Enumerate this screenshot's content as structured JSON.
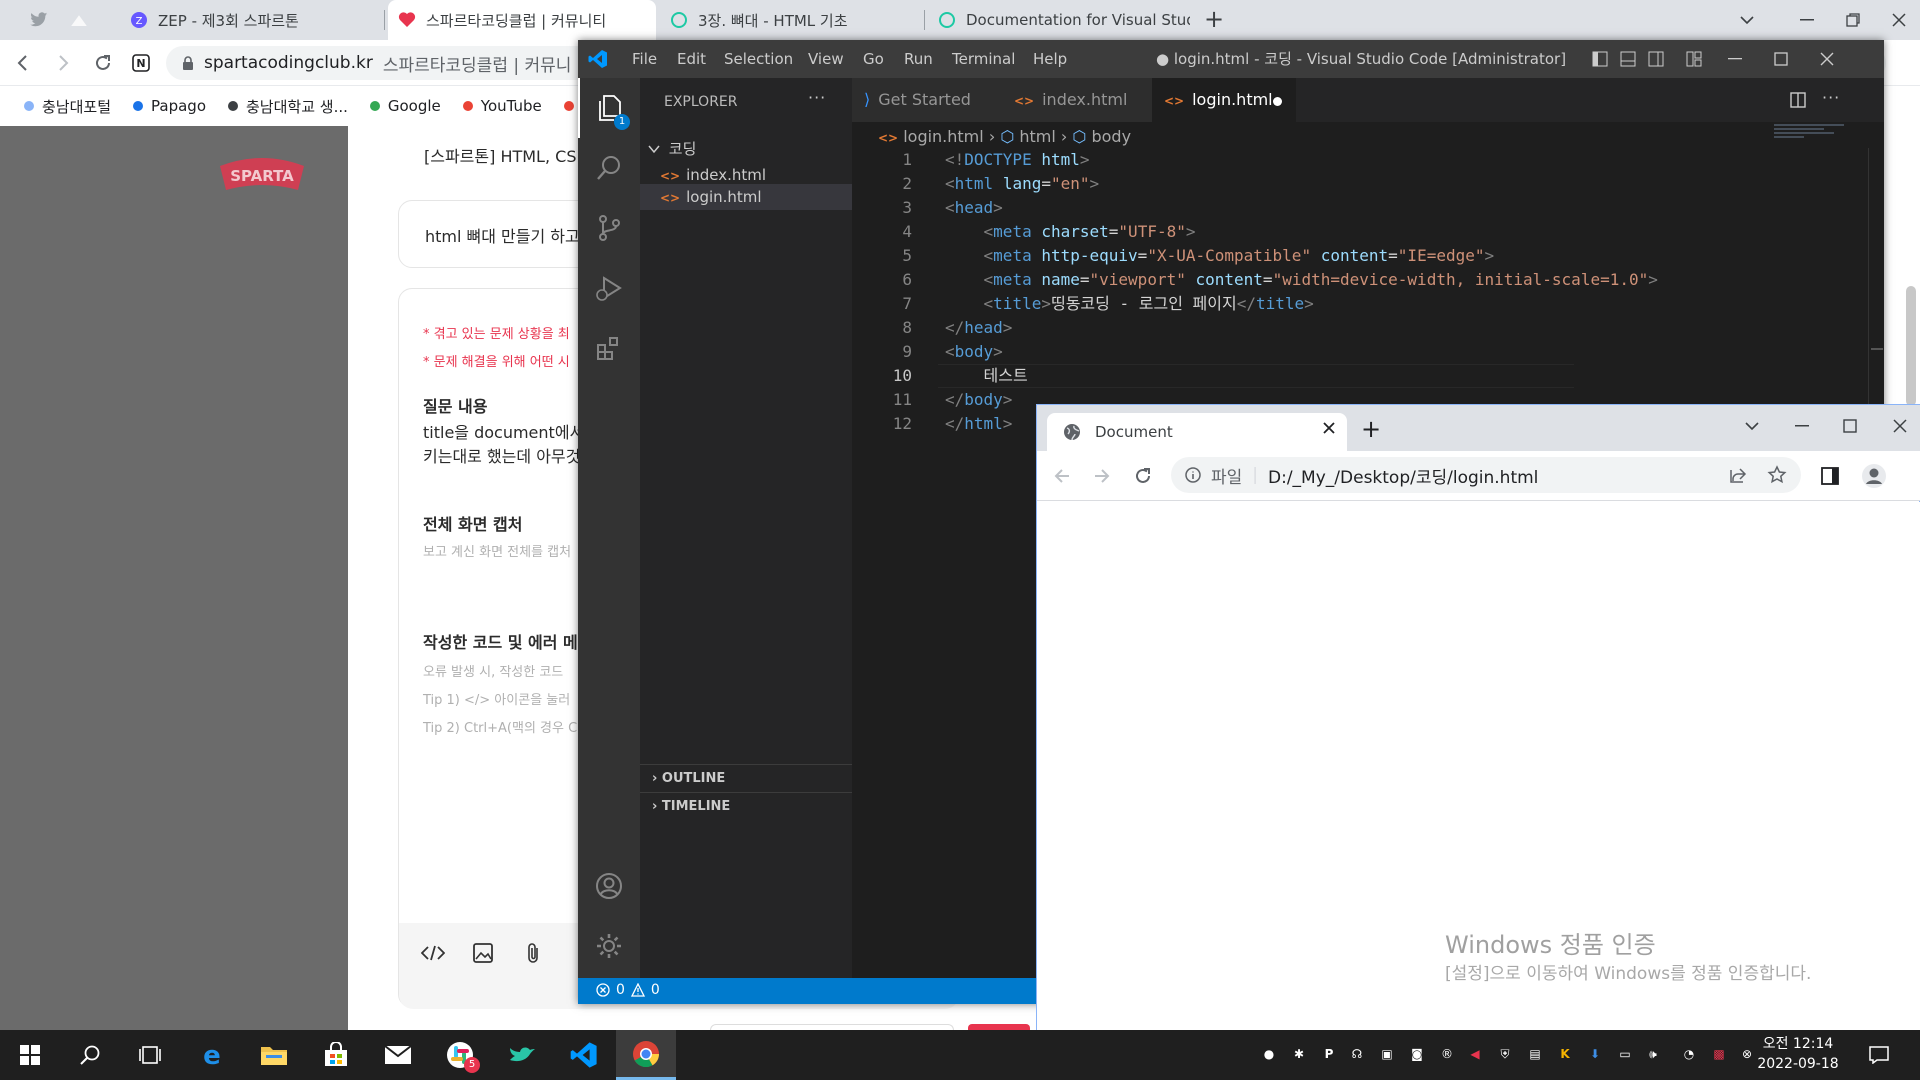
{
  "browser": {
    "tabs": [
      {
        "title": "ZEP - 제3회 스파르톤"
      },
      {
        "title": "스파르타코딩클럽 | 커뮤니티"
      },
      {
        "title": "3장. 뼈대 - HTML 기초"
      },
      {
        "title": "Documentation for Visual Studi"
      }
    ],
    "address": {
      "host": "spartacodingclub.kr",
      "rest": "스파르타코딩클럽 | 커뮤니"
    },
    "bookmarks": [
      {
        "label": "충남대포털",
        "color": "#8ab4f8"
      },
      {
        "label": "Papago",
        "color": "#1a73e8"
      },
      {
        "label": "충남대학교 생...",
        "color": "#3c4043"
      },
      {
        "label": "Google",
        "color": "#34a853"
      },
      {
        "label": "YouTube",
        "color": "#ea4335"
      }
    ]
  },
  "page": {
    "logo": "SPARTA",
    "course_title": "[스파르톤] HTML, CS",
    "question_title": "html 뼈대 만들기 하고",
    "hint1": "* 겪고 있는 문제 상황을 최",
    "hint2": "* 문제 해결을 위해 어떤 시",
    "q_label": "질문 내용",
    "q_line1": "title을 document에서",
    "q_line2": "키는대로 했는데 아무것",
    "cap_label": "전체 화면 캡처",
    "cap_hint": "보고 계신 화면 전체를 캡처",
    "code_label": "작성한 코드 및 에러 메시",
    "code_hint1": "오류 발생 시, 작성한 코드",
    "code_hint2": "Tip 1) </> 아이콘을 눌러",
    "code_hint3": "Tip 2) Ctrl+A(맥의 경우 C"
  },
  "vscode": {
    "menu": [
      "File",
      "Edit",
      "Selection",
      "View",
      "Go",
      "Run",
      "Terminal",
      "Help"
    ],
    "window_title": "● login.html - 코딩 - Visual Studio Code [Administrator]",
    "explorer_label": "EXPLORER",
    "folder": "코딩",
    "files": [
      "index.html",
      "login.html"
    ],
    "outline": "OUTLINE",
    "timeline": "TIMELINE",
    "tabs": [
      "Get Started",
      "index.html",
      "login.html"
    ],
    "breadcrumb": [
      "login.html",
      "html",
      "body"
    ],
    "badge": "1",
    "status_errors": "0",
    "status_warnings": "0",
    "lines": [
      {
        "n": "1",
        "parts": [
          [
            "pu",
            "<!"
          ],
          [
            "tg",
            "DOCTYPE"
          ],
          [
            "tx",
            " "
          ],
          [
            "at",
            "html"
          ],
          [
            "pu",
            ">"
          ]
        ]
      },
      {
        "n": "2",
        "parts": [
          [
            "pu",
            "<"
          ],
          [
            "tg",
            "html"
          ],
          [
            "tx",
            " "
          ],
          [
            "at",
            "lang"
          ],
          [
            "tx",
            "="
          ],
          [
            "st",
            "\"en\""
          ],
          [
            "pu",
            ">"
          ]
        ]
      },
      {
        "n": "3",
        "parts": [
          [
            "pu",
            "<"
          ],
          [
            "tg",
            "head"
          ],
          [
            "pu",
            ">"
          ]
        ]
      },
      {
        "n": "4",
        "parts": [
          [
            "tx",
            "    "
          ],
          [
            "pu",
            "<"
          ],
          [
            "tg",
            "meta"
          ],
          [
            "tx",
            " "
          ],
          [
            "at",
            "charset"
          ],
          [
            "tx",
            "="
          ],
          [
            "st",
            "\"UTF-8\""
          ],
          [
            "pu",
            ">"
          ]
        ]
      },
      {
        "n": "5",
        "parts": [
          [
            "tx",
            "    "
          ],
          [
            "pu",
            "<"
          ],
          [
            "tg",
            "meta"
          ],
          [
            "tx",
            " "
          ],
          [
            "at",
            "http-equiv"
          ],
          [
            "tx",
            "="
          ],
          [
            "st",
            "\"X-UA-Compatible\""
          ],
          [
            "tx",
            " "
          ],
          [
            "at",
            "content"
          ],
          [
            "tx",
            "="
          ],
          [
            "st",
            "\"IE=edge\""
          ],
          [
            "pu",
            ">"
          ]
        ]
      },
      {
        "n": "6",
        "parts": [
          [
            "tx",
            "    "
          ],
          [
            "pu",
            "<"
          ],
          [
            "tg",
            "meta"
          ],
          [
            "tx",
            " "
          ],
          [
            "at",
            "name"
          ],
          [
            "tx",
            "="
          ],
          [
            "st",
            "\"viewport\""
          ],
          [
            "tx",
            " "
          ],
          [
            "at",
            "content"
          ],
          [
            "tx",
            "="
          ],
          [
            "st",
            "\"width=device-width, initial-scale=1.0\""
          ],
          [
            "pu",
            ">"
          ]
        ]
      },
      {
        "n": "7",
        "parts": [
          [
            "tx",
            "    "
          ],
          [
            "pu",
            "<"
          ],
          [
            "tg",
            "title"
          ],
          [
            "pu",
            ">"
          ],
          [
            "tx",
            "띵동코딩 - 로그인 페이지"
          ],
          [
            "pu",
            "</"
          ],
          [
            "tg",
            "title"
          ],
          [
            "pu",
            ">"
          ]
        ]
      },
      {
        "n": "8",
        "parts": [
          [
            "pu",
            "</"
          ],
          [
            "tg",
            "head"
          ],
          [
            "pu",
            ">"
          ]
        ]
      },
      {
        "n": "9",
        "parts": [
          [
            "pu",
            "<"
          ],
          [
            "tg",
            "body"
          ],
          [
            "pu",
            ">"
          ]
        ]
      },
      {
        "n": "10",
        "parts": [
          [
            "tx",
            "    테스트"
          ]
        ]
      },
      {
        "n": "11",
        "parts": [
          [
            "pu",
            "</"
          ],
          [
            "tg",
            "body"
          ],
          [
            "pu",
            ">"
          ]
        ]
      },
      {
        "n": "12",
        "parts": [
          [
            "pu",
            "</"
          ],
          [
            "tg",
            "html"
          ],
          [
            "pu",
            ">"
          ]
        ]
      }
    ]
  },
  "docwin": {
    "tab_title": "Document",
    "prefix": "파일",
    "url": "D:/_My_/Desktop/코딩/login.html"
  },
  "activation": {
    "line1": "Windows 정품 인증",
    "line2": "[설정]으로 이동하여 Windows를 정품 인증합니다."
  },
  "taskbar": {
    "time": "오전 12:14",
    "date": "2022-09-18",
    "chat_badge": "5"
  }
}
